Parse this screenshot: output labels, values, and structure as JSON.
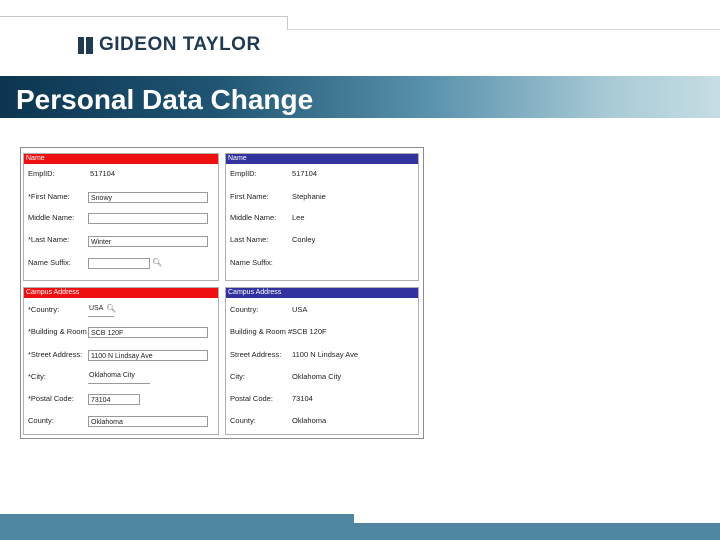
{
  "brand": {
    "logo_text": "GIDEON TAYLOR"
  },
  "slide": {
    "title": "Personal Data Change"
  },
  "icons": {
    "lookup": "magnifier-icon"
  },
  "colors": {
    "old_header": "#ef1111",
    "new_header": "#3333a0",
    "title_band": "#1f5573"
  },
  "old": {
    "name": {
      "header": "Name",
      "emplid_label": "EmplID:",
      "emplid_value": "517104",
      "first_label": "*First Name:",
      "first_value": "Snowy",
      "middle_label": "Middle Name:",
      "middle_value": "",
      "last_label": "*Last Name:",
      "last_value": "Winter",
      "suffix_label": "Name Suffix:",
      "suffix_value": ""
    },
    "address": {
      "header": "Campus Address",
      "country_label": "*Country:",
      "country_value": "USA",
      "building_label": "*Building & Room #:",
      "building_value": "SCB 120F",
      "street_label": "*Street Address:",
      "street_value": "1100 N Lindsay Ave",
      "city_label": "*City:",
      "city_value": "Oklahoma City",
      "postal_label": "*Postal Code:",
      "postal_value": "73104",
      "county_label": "County:",
      "county_value": "Oklahoma"
    }
  },
  "new": {
    "name": {
      "header": "Name",
      "emplid_label": "EmplID:",
      "emplid_value": "517104",
      "first_label": "First Name:",
      "first_value": "Stephanie",
      "middle_label": "Middle Name:",
      "middle_value": "Lee",
      "last_label": "Last Name:",
      "last_value": "Conley",
      "suffix_label": "Name Suffix:",
      "suffix_value": ""
    },
    "address": {
      "header": "Campus Address",
      "country_label": "Country:",
      "country_value": "USA",
      "building_label": "Building & Room #:",
      "building_value": "SCB 120F",
      "street_label": "Street Address:",
      "street_value": "1100 N Lindsay Ave",
      "city_label": "City:",
      "city_value": "Oklahoma City",
      "postal_label": "Postal Code:",
      "postal_value": "73104",
      "county_label": "County:",
      "county_value": "Oklahoma"
    }
  }
}
